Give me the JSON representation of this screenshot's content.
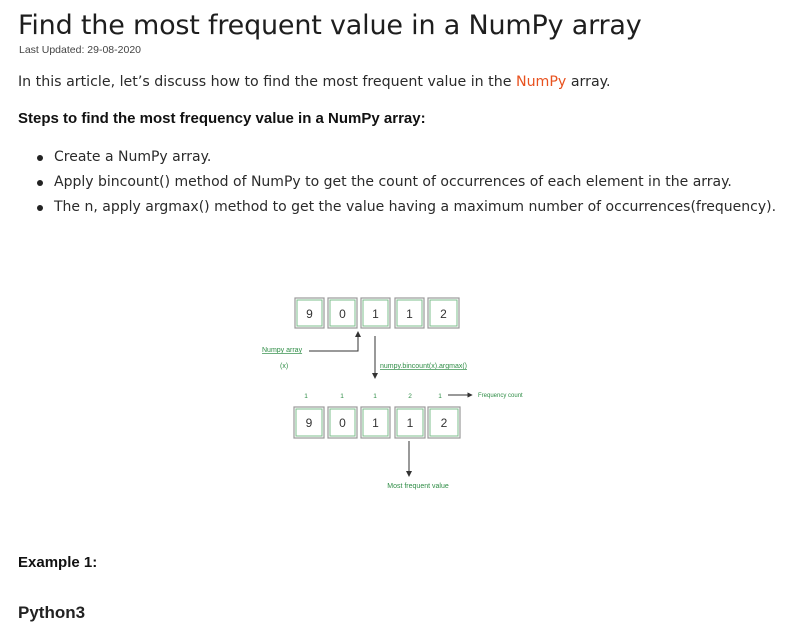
{
  "article": {
    "title": "Find the most frequent value in a NumPy array",
    "last_updated": "Last Updated: 29-08-2020",
    "intro_before": "In this article, let’s discuss how to find the most frequent value in the ",
    "intro_link": "NumPy",
    "intro_after": " array.",
    "steps_heading": "Steps to find the most frequency value in a NumPy array:",
    "steps": [
      "Create a NumPy array.",
      "Apply bincount() method of NumPy to get the count of occurrences of each element in the array.",
      "The n, apply argmax() method to get the value having a maximum number of occurrences(frequency)."
    ],
    "example_heading": "Example 1:",
    "language_heading": "Python3"
  },
  "diagram": {
    "top_array": [
      "9",
      "0",
      "1",
      "1",
      "2"
    ],
    "bottom_array": [
      "9",
      "0",
      "1",
      "1",
      "2"
    ],
    "counts": [
      "1",
      "1",
      "1",
      "2",
      "1"
    ],
    "array_label_line1": "Numpy array",
    "array_label_line2": "(x)",
    "operation_label": "numpy.bincount(x).argmax()",
    "frequency_label": "Frequency count",
    "result_label": "Most frequent value",
    "colors": {
      "accent": "#2f8d46",
      "link": "#e8521f",
      "cell_border": "#7cbf8c"
    }
  }
}
